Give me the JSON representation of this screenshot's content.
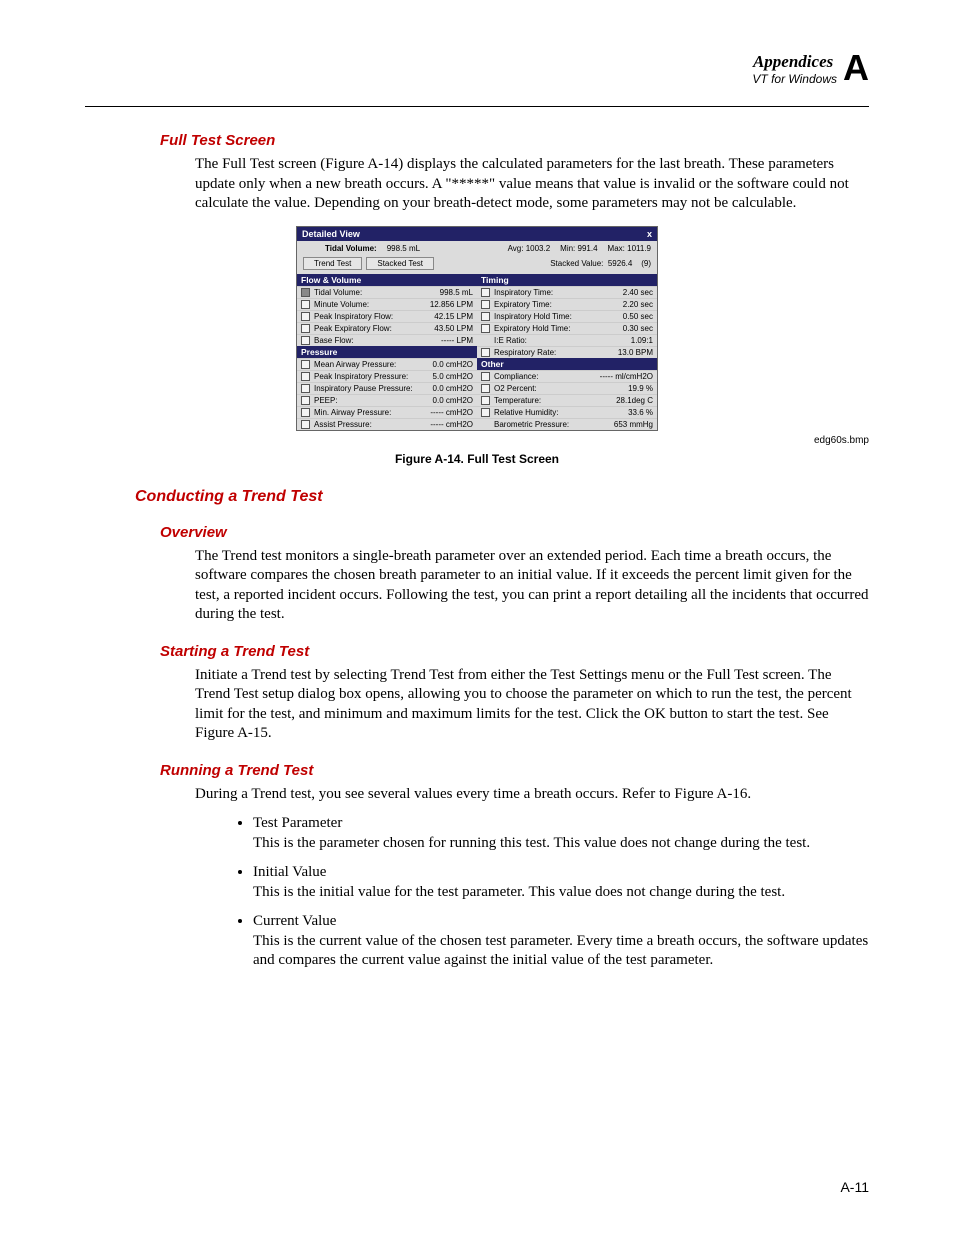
{
  "header": {
    "appendices": "Appendices",
    "letter": "A",
    "sub": "VT for Windows"
  },
  "sec_fulltest": {
    "title": "Full Test Screen",
    "para": "The Full Test screen (Figure A-14) displays the calculated parameters for the last breath. These parameters update only when a new breath occurs. A \"*****\" value means that value is invalid or the software could not calculate the value. Depending on your breath-detect mode, some parameters may not be calculable."
  },
  "figure": {
    "caption": "Figure A-14. Full Test Screen",
    "filename": "edg60s.bmp",
    "shot": {
      "title": "Detailed View",
      "close": "x",
      "tidal_label": "Tidal Volume:",
      "tidal_value": "998.5 mL",
      "avg_label": "Avg:",
      "avg_value": "1003.2",
      "min_label": "Min:",
      "min_value": "991.4",
      "max_label": "Max:",
      "max_value": "1011.9",
      "btn_trend": "Trend Test",
      "btn_stacked": "Stacked Test",
      "stacked_label": "Stacked Value:",
      "stacked_value": "5926.4",
      "count": "(9)",
      "left": {
        "flow_head": "Flow & Volume",
        "flow_items": [
          {
            "label": "Tidal Volume:",
            "value": "998.5 mL",
            "x": true
          },
          {
            "label": "Minute Volume:",
            "value": "12.856 LPM",
            "x": false
          },
          {
            "label": "Peak Inspiratory Flow:",
            "value": "42.15 LPM",
            "x": false
          },
          {
            "label": "Peak Expiratory Flow:",
            "value": "43.50 LPM",
            "x": false
          },
          {
            "label": "Base Flow:",
            "value": "----- LPM",
            "x": false
          }
        ],
        "press_head": "Pressure",
        "press_items": [
          {
            "label": "Mean Airway Pressure:",
            "value": "0.0 cmH2O",
            "x": false
          },
          {
            "label": "Peak Inspiratory Pressure:",
            "value": "5.0 cmH2O",
            "x": false
          },
          {
            "label": "Inspiratory Pause Pressure:",
            "value": "0.0 cmH2O",
            "x": false
          },
          {
            "label": "PEEP:",
            "value": "0.0 cmH2O",
            "x": false
          },
          {
            "label": "Min. Airway Pressure:",
            "value": "----- cmH2O",
            "x": false
          },
          {
            "label": "Assist Pressure:",
            "value": "----- cmH2O",
            "x": false
          }
        ]
      },
      "right": {
        "timing_head": "Timing",
        "timing_items": [
          {
            "label": "Inspiratory Time:",
            "value": "2.40 sec",
            "x": false
          },
          {
            "label": "Expiratory Time:",
            "value": "2.20 sec",
            "x": false
          },
          {
            "label": "Inspiratory Hold Time:",
            "value": "0.50 sec",
            "x": false
          },
          {
            "label": "Expiratory Hold Time:",
            "value": "0.30 sec",
            "x": false
          },
          {
            "label": "I:E Ratio:",
            "value": "1.09:1",
            "noicon": true
          },
          {
            "label": "Respiratory Rate:",
            "value": "13.0 BPM",
            "x": false
          }
        ],
        "other_head": "Other",
        "other_items": [
          {
            "label": "Compliance:",
            "value": "----- ml/cmH2O",
            "x": false
          },
          {
            "label": "O2 Percent:",
            "value": "19.9 %",
            "x": false
          },
          {
            "label": "Temperature:",
            "value": "28.1deg C",
            "x": false
          },
          {
            "label": "Relative Humidity:",
            "value": "33.6 %",
            "x": false
          },
          {
            "label": "Barometric Pressure:",
            "value": "653 mmHg",
            "noicon": true
          }
        ]
      }
    }
  },
  "sec_conducting": {
    "title": "Conducting a Trend Test"
  },
  "sec_overview": {
    "title": "Overview",
    "para": "The Trend test monitors a single-breath parameter over an extended period. Each time a breath occurs, the software compares the chosen breath parameter to an initial value. If it exceeds the percent limit given for the test, a reported incident occurs. Following the test, you can print a report detailing all the incidents that occurred during the test."
  },
  "sec_starting": {
    "title": "Starting a Trend Test",
    "para": "Initiate a Trend test by selecting Trend Test from either the Test Settings menu or the Full Test screen. The Trend Test setup dialog box opens, allowing you to choose the parameter on which to run the test, the percent limit for the test, and minimum and maximum limits for the test. Click the OK button to start the test. See Figure A-15."
  },
  "sec_running": {
    "title": "Running a Trend Test",
    "para": "During a Trend test, you see several values every time a breath occurs. Refer to Figure A-16.",
    "items": [
      {
        "term": "Test Parameter",
        "desc": "This is the parameter chosen for running this test. This value does not change during the test."
      },
      {
        "term": "Initial Value",
        "desc": "This is the initial value for the test parameter. This value does not change during the test."
      },
      {
        "term": "Current Value",
        "desc": "This is the current value of the chosen test parameter. Every time a breath occurs, the software updates and compares the current value against the initial value of the test parameter."
      }
    ]
  },
  "page_num": "A-11"
}
